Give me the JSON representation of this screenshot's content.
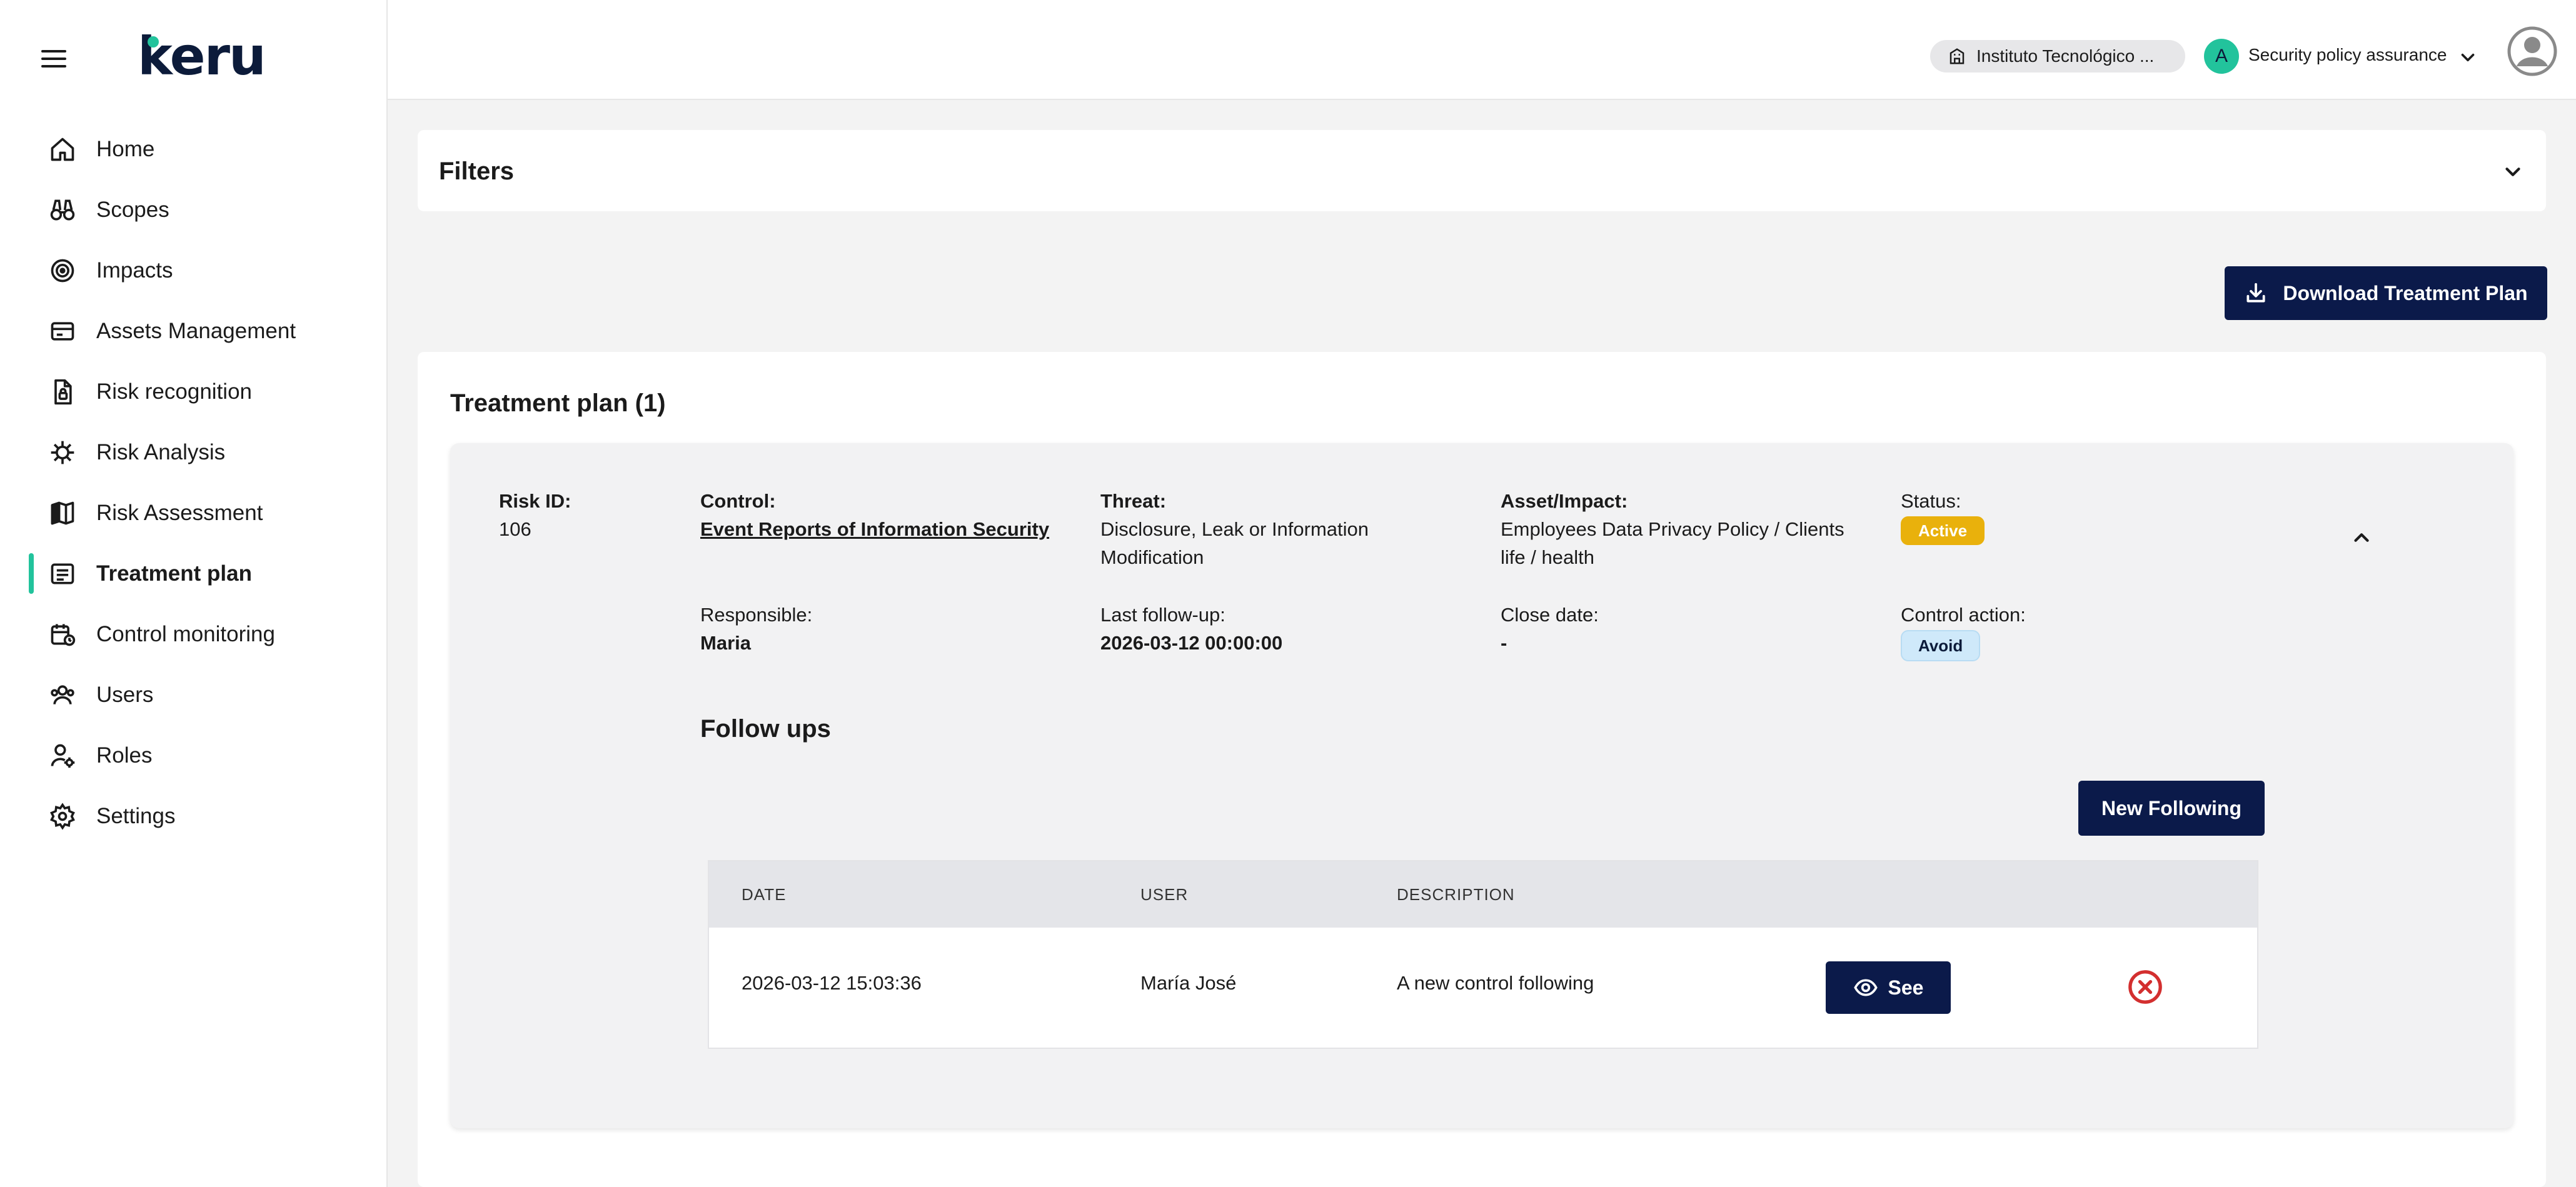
{
  "app": {
    "logo": "keru"
  },
  "header": {
    "institution": "Instituto Tecnológico ...",
    "org_initial": "A",
    "org_name": "Security policy assurance"
  },
  "sidebar": {
    "items": [
      {
        "label": "Home",
        "icon": "home-icon"
      },
      {
        "label": "Scopes",
        "icon": "binoculars-icon"
      },
      {
        "label": "Impacts",
        "icon": "radar-icon"
      },
      {
        "label": "Assets Management",
        "icon": "card-icon"
      },
      {
        "label": "Risk recognition",
        "icon": "file-lock-icon"
      },
      {
        "label": "Risk Analysis",
        "icon": "virus-icon"
      },
      {
        "label": "Risk Assessment",
        "icon": "map-icon"
      },
      {
        "label": "Treatment plan",
        "icon": "list-icon",
        "active": true
      },
      {
        "label": "Control monitoring",
        "icon": "calendar-monitor-icon"
      },
      {
        "label": "Users",
        "icon": "users-icon"
      },
      {
        "label": "Roles",
        "icon": "user-gear-icon"
      },
      {
        "label": "Settings",
        "icon": "gear-icon"
      }
    ]
  },
  "filters": {
    "title": "Filters"
  },
  "actions": {
    "download_label": "Download Treatment Plan"
  },
  "treatment_plan": {
    "title": "Treatment plan (1)",
    "risk": {
      "risk_id_label": "Risk ID:",
      "risk_id": "106",
      "control_label": "Control:",
      "control": "Event Reports of Information Security",
      "threat_label": "Threat:",
      "threat_line1": "Disclosure, Leak or Information",
      "threat_line2": "Modification",
      "asset_label": "Asset/Impact:",
      "asset_line1": "Employees Data Privacy Policy / Clients",
      "asset_line2": "life / health",
      "status_label": "Status:",
      "status": "Active",
      "responsible_label": "Responsible:",
      "responsible": "Maria",
      "last_followup_label": "Last follow-up:",
      "last_followup": "2026-03-12 00:00:00",
      "close_date_label": "Close date:",
      "close_date": "-",
      "control_action_label": "Control action:",
      "control_action": "Avoid"
    },
    "follow_ups": {
      "title": "Follow ups",
      "new_label": "New Following",
      "columns": [
        "DATE",
        "USER",
        "DESCRIPTION"
      ],
      "rows": [
        {
          "date": "2026-03-12 15:03:36",
          "user": "María José",
          "description": "A new control following",
          "see_label": "See"
        }
      ]
    }
  },
  "colors": {
    "accent": "#22c39c",
    "primary_button": "#0b1a4a",
    "status_active": "#e9b10c",
    "action_avoid": "#cfe9fa",
    "delete": "#d32f2f"
  }
}
